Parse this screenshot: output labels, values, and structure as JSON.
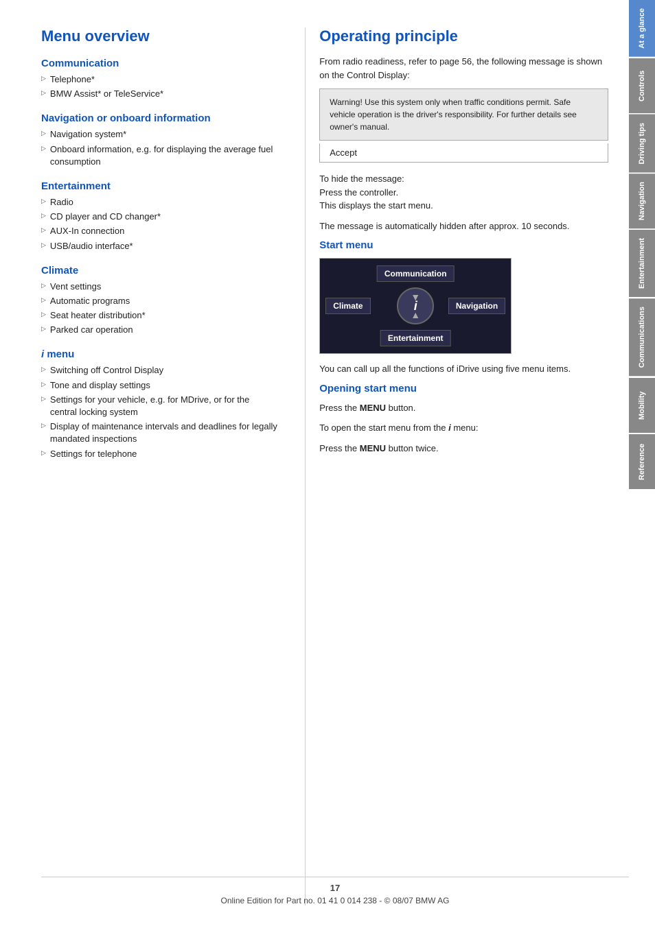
{
  "tabs": [
    {
      "label": "At a glance",
      "active": true,
      "class": "tab-at-glance"
    },
    {
      "label": "Controls",
      "active": false,
      "class": "tab-controls"
    },
    {
      "label": "Driving tips",
      "active": false,
      "class": "tab-driving"
    },
    {
      "label": "Navigation",
      "active": false,
      "class": "tab-navigation"
    },
    {
      "label": "Entertainment",
      "active": false,
      "class": "tab-entertainment"
    },
    {
      "label": "Communications",
      "active": false,
      "class": "tab-communications"
    },
    {
      "label": "Mobility",
      "active": false,
      "class": "tab-mobility"
    },
    {
      "label": "Reference",
      "active": false,
      "class": "tab-reference"
    }
  ],
  "left_column": {
    "title": "Menu overview",
    "sections": [
      {
        "id": "communication",
        "heading": "Communication",
        "items": [
          "Telephone*",
          "BMW Assist* or TeleService*"
        ]
      },
      {
        "id": "navigation",
        "heading": "Navigation or onboard information",
        "items": [
          "Navigation system*",
          "Onboard information, e.g. for displaying the average fuel consumption"
        ]
      },
      {
        "id": "entertainment",
        "heading": "Entertainment",
        "items": [
          "Radio",
          "CD player and CD changer*",
          "AUX-In connection",
          "USB/audio interface*"
        ]
      },
      {
        "id": "climate",
        "heading": "Climate",
        "items": [
          "Vent settings",
          "Automatic programs",
          "Seat heater distribution*",
          "Parked car operation"
        ]
      }
    ],
    "imenu": {
      "heading_prefix": "i",
      "heading_suffix": " menu",
      "items": [
        "Switching off Control Display",
        "Tone and display settings",
        "Settings for your vehicle, e.g. for MDrive, or for the central locking system",
        "Display of maintenance intervals and deadlines for legally mandated inspections",
        "Settings for telephone"
      ]
    }
  },
  "right_column": {
    "title": "Operating principle",
    "intro_text": "From radio readiness, refer to page 56, the following message is shown on the Control Display:",
    "warning_box": {
      "text": "Warning! Use this system only when traffic conditions permit. Safe vehicle operation is the driver's responsibility. For further details see owner's manual."
    },
    "accept_label": "Accept",
    "hide_message_intro": "To hide the message:",
    "step1": "Press the controller.",
    "step2": "This displays the start menu.",
    "auto_hide": "The message is automatically hidden after approx. 10 seconds.",
    "start_menu_title": "Start menu",
    "idrive_labels": {
      "top": "Communication",
      "left": "Climate",
      "center": "i",
      "right": "Navigation",
      "bottom": "Entertainment"
    },
    "idrive_description": "You can call up all the functions of iDrive using five menu items.",
    "opening_start_title": "Opening start menu",
    "opening_step1_prefix": "Press the ",
    "opening_step1_menu": "MENU",
    "opening_step1_suffix": " button.",
    "opening_step2_prefix": "To open the start menu from the ",
    "opening_step2_i": "i",
    "opening_step2_middle": " menu:",
    "opening_step3_prefix": "Press the ",
    "opening_step3_menu": "MENU",
    "opening_step3_suffix": " button twice."
  },
  "footer": {
    "page_number": "17",
    "copyright": "Online Edition for Part no. 01 41 0 014 238 - © 08/07 BMW AG"
  }
}
